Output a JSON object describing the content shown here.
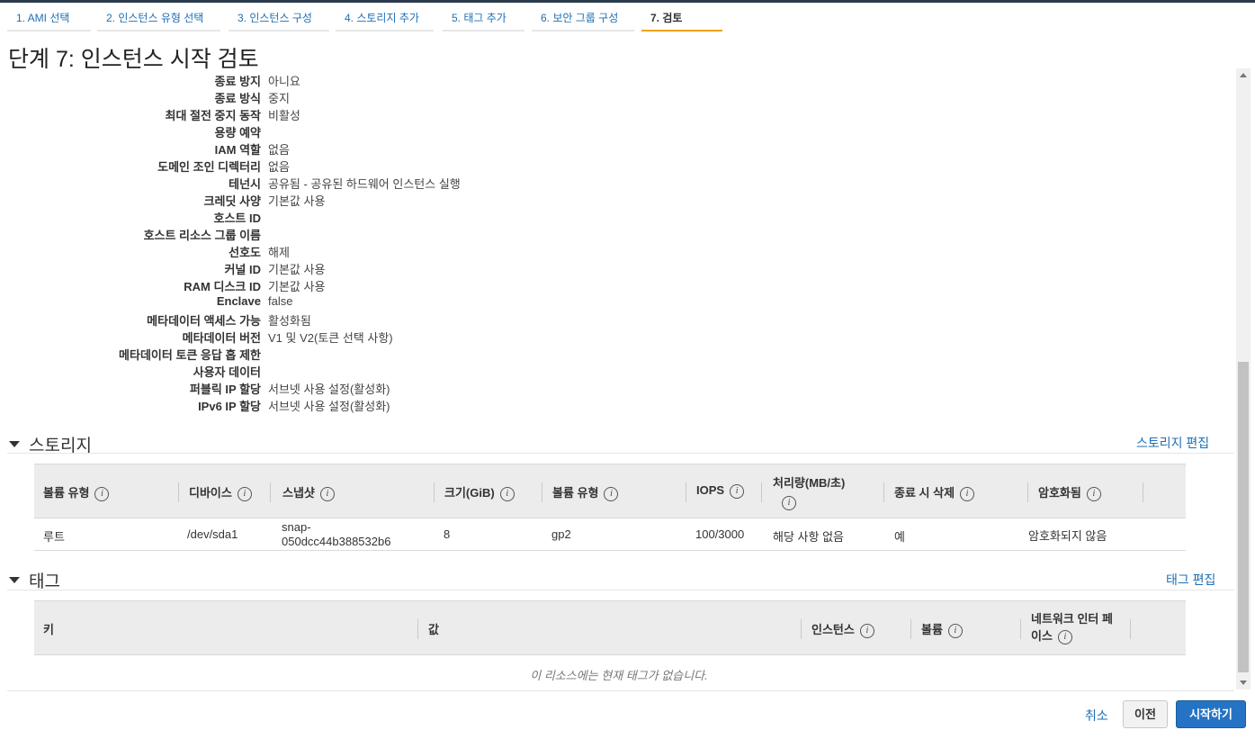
{
  "tabs": [
    {
      "label": "1. AMI 선택"
    },
    {
      "label": "2. 인스턴스 유형 선택"
    },
    {
      "label": "3. 인스턴스 구성"
    },
    {
      "label": "4. 스토리지 추가"
    },
    {
      "label": "5. 태그 추가"
    },
    {
      "label": "6. 보안 그룹 구성"
    },
    {
      "label": "7. 검토"
    }
  ],
  "page_title": "단계 7: 인스턴스 시작 검토",
  "details": [
    {
      "label": "종료 방지",
      "value": "아니요"
    },
    {
      "label": "종료 방식",
      "value": "중지"
    },
    {
      "label": "최대 절전 중지 동작",
      "value": "비활성"
    },
    {
      "label": "용량 예약",
      "value": ""
    },
    {
      "label": "IAM 역할",
      "value": "없음"
    },
    {
      "label": "도메인 조인 디렉터리",
      "value": "없음"
    },
    {
      "label": "테넌시",
      "value": "공유됨 - 공유된 하드웨어 인스턴스 실행"
    },
    {
      "label": "크레딧 사양",
      "value": "기본값 사용"
    },
    {
      "label": "호스트 ID",
      "value": ""
    },
    {
      "label": "호스트 리소스 그룹 이름",
      "value": ""
    },
    {
      "label": "선호도",
      "value": "해제"
    },
    {
      "label": "커널 ID",
      "value": "기본값 사용"
    },
    {
      "label": "RAM 디스크 ID",
      "value": "기본값 사용"
    },
    {
      "label": "Enclave",
      "value": "false"
    },
    {
      "label": "메타데이터 액세스 가능",
      "value": "활성화됨"
    },
    {
      "label": "메타데이터 버전",
      "value": "V1 및 V2(토큰 선택 사항)"
    },
    {
      "label": "메타데이터 토큰 응답 홉 제한",
      "value": ""
    },
    {
      "label": "사용자 데이터",
      "value": ""
    },
    {
      "label": "퍼블릭 IP 할당",
      "value": "서브넷 사용 설정(활성화)"
    },
    {
      "label": "IPv6 IP 할당",
      "value": "서브넷 사용 설정(활성화)"
    }
  ],
  "storage": {
    "title": "스토리지",
    "edit_label": "스토리지 편집",
    "columns": [
      {
        "label": "볼륨 유형"
      },
      {
        "label": "디바이스"
      },
      {
        "label": "스냅샷"
      },
      {
        "label": "크기(GiB)"
      },
      {
        "label": "볼륨 유형"
      },
      {
        "label": "IOPS"
      },
      {
        "label": "처리량(MB/초)"
      },
      {
        "label": "종료 시 삭제"
      },
      {
        "label": "암호화됨"
      }
    ],
    "rows": [
      {
        "volume_type": "루트",
        "device": "/dev/sda1",
        "snapshot_line1": "snap-",
        "snapshot_line2": "050dcc44b388532b6",
        "size": "8",
        "type": "gp2",
        "iops": "100/3000",
        "throughput": "해당 사항 없음",
        "delete_on_termination": "예",
        "encrypted": "암호화되지 않음"
      }
    ]
  },
  "tags": {
    "title": "태그",
    "edit_label": "태그 편집",
    "columns": [
      {
        "label": "키"
      },
      {
        "label": "값"
      },
      {
        "label": "인스턴스"
      },
      {
        "label": "볼륨"
      },
      {
        "label": "네트워크 인터 페이스"
      }
    ],
    "empty_message": "이 리소스에는 현재 태그가 없습니다."
  },
  "footer": {
    "cancel_label": "취소",
    "prev_label": "이전",
    "launch_label": "시작하기"
  },
  "colors": {
    "link": "#1e6fb5",
    "active_tab_underline": "#f0a21f",
    "primary_button": "#2573c4"
  }
}
